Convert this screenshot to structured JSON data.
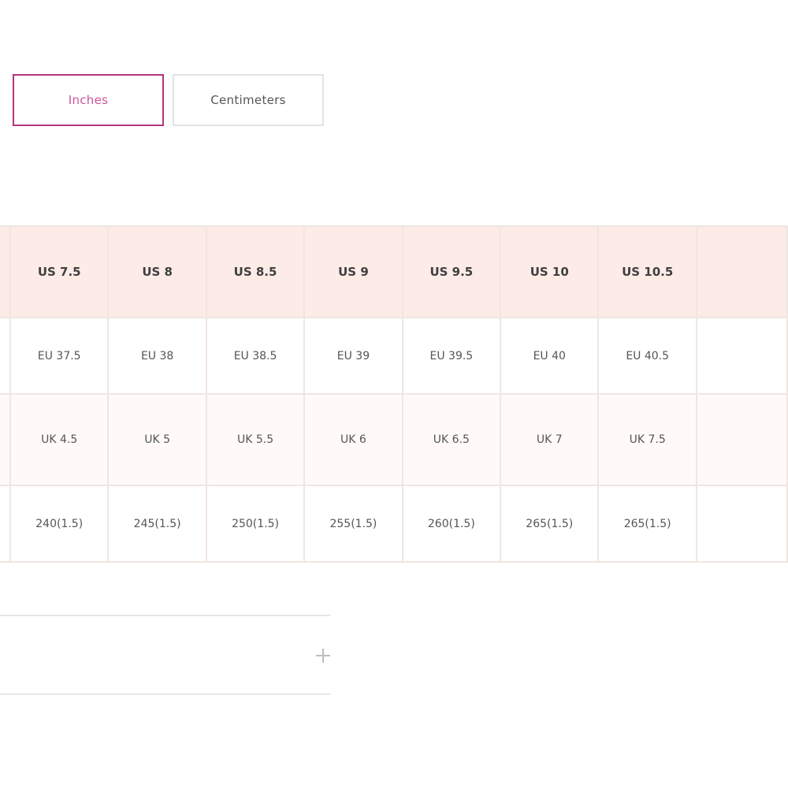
{
  "unit_toggle": {
    "inches_label": "Inches",
    "centimeters_label": "Centimeters",
    "selected": "Inches"
  },
  "size_table": {
    "us": [
      "",
      "US 7.5",
      "US 8",
      "US 8.5",
      "US 9",
      "US 9.5",
      "US 10",
      "US 10.5",
      ""
    ],
    "eu": [
      "",
      "EU 37.5",
      "EU 38",
      "EU 38.5",
      "EU 39",
      "EU 39.5",
      "EU 40",
      "EU 40.5",
      ""
    ],
    "uk": [
      "",
      "UK 4.5",
      "UK 5",
      "UK 5.5",
      "UK 6",
      "UK 6.5",
      "UK 7",
      "UK 7.5",
      ""
    ],
    "cm": [
      "",
      "240(1.5)",
      "245(1.5)",
      "250(1.5)",
      "255(1.5)",
      "260(1.5)",
      "265(1.5)",
      "265(1.5)",
      ""
    ]
  },
  "accordion": {
    "label": ""
  },
  "colors": {
    "accent": "#b4357d",
    "accent_text": "#d0549c",
    "header_bg": "#fdebe7",
    "border": "#f0e6e2"
  }
}
